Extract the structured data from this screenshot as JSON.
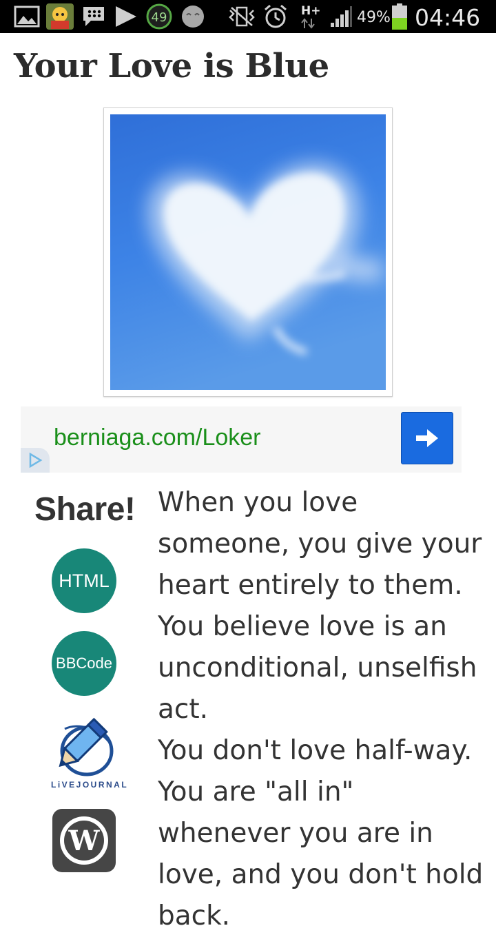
{
  "status_bar": {
    "notification_count": "49",
    "battery_percent": "49%",
    "time": "04:46",
    "network_type": "H+",
    "icons": [
      "gallery-icon",
      "app-avatar-icon",
      "bbm-icon",
      "play-store-icon",
      "counter-badge-icon",
      "emoji-icon",
      "vibrate-icon",
      "alarm-icon",
      "data-transfer-icon",
      "signal-icon",
      "battery-icon"
    ],
    "battery_color": "#7ed321"
  },
  "article": {
    "title": "Your Love is Blue",
    "image_icon": "heart-cloud-image"
  },
  "ad": {
    "link_text": "berniaga.com/Loker",
    "link_color": "#1a8f1a",
    "button_icon": "arrow-right-icon",
    "button_color": "#1a6be0",
    "badge_icon": "adchoices-icon"
  },
  "share": {
    "heading": "Share!",
    "html_label": "HTML",
    "bbcode_label": "BBCode",
    "livejournal_label": "LiVEJOURNAL",
    "livejournal_icon": "livejournal-pencil-icon",
    "wordpress_icon": "wordpress-icon",
    "accent_color": "#188778"
  },
  "body": {
    "paragraph_1": "When you love someone, you give your heart entirely to them. You believe love is an unconditional, unselfish act.",
    "paragraph_2": "You don't love half-way. You are \"all in\" whenever you are in love, and you don't hold back."
  }
}
